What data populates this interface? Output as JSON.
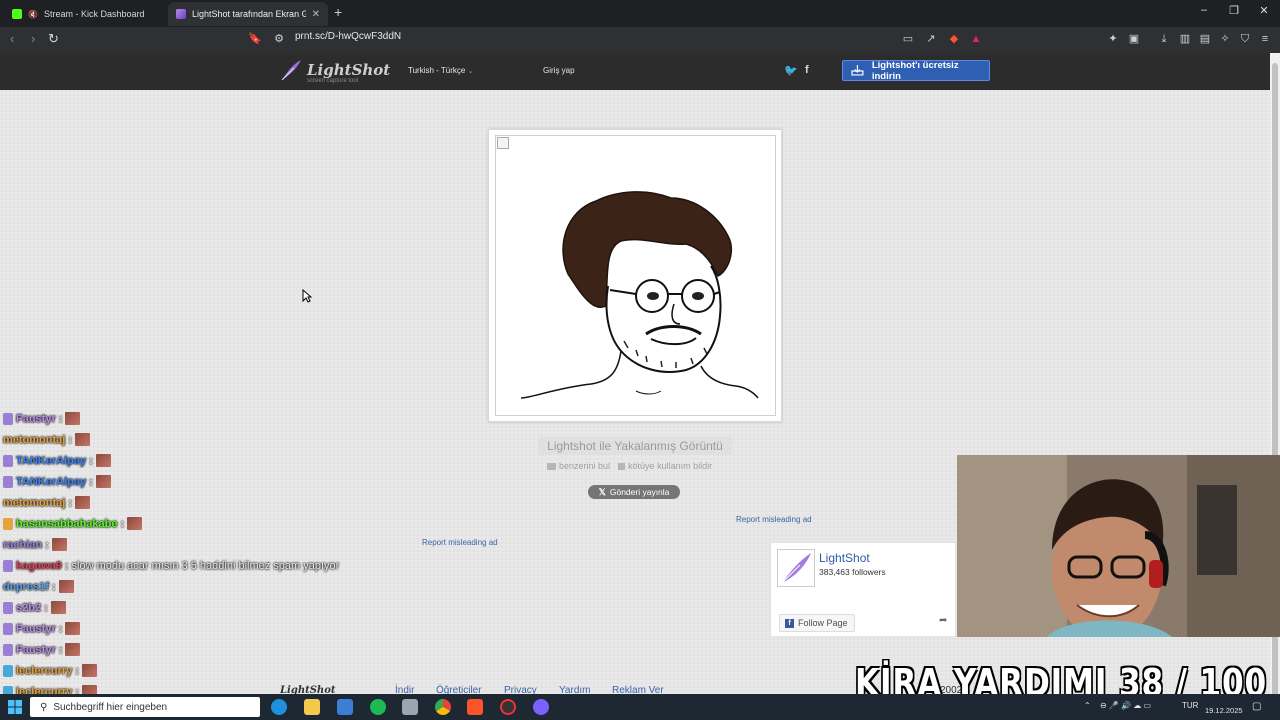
{
  "browser": {
    "tabs": [
      {
        "title": "Stream - Kick Dashboard",
        "active": false
      },
      {
        "title": "LightShot tarafından Ekran Görü",
        "active": true
      }
    ],
    "url": "prnt.sc/D-hwQcwF3ddN"
  },
  "lightshot": {
    "logo_text": "LightShot",
    "logo_sub": "screen capture tool",
    "language": "Turkish - Türkçe",
    "login": "Giriş yap",
    "download_button": "Lightshot'ı ücretsiz indirin",
    "image_caption": "Lightshot ile Yakalanmış Görüntü",
    "find_similar": "benzerini bul",
    "report_abuse": "kötüye kullanım bildir",
    "tweet_button": "Gönderi yayınla",
    "report_ad_left": "Report misleading ad",
    "report_ad_right": "Report misleading ad",
    "fb_page_name": "LightShot",
    "fb_followers": "383,463 followers",
    "fb_follow_button": "Follow Page",
    "footer": {
      "download": "İndir",
      "tutorials": "Öğreticiler",
      "privacy": "Privacy",
      "help": "Yardım",
      "ads": "Reklam Ver",
      "year": "2002"
    }
  },
  "chat": [
    {
      "user": "Faustyr",
      "color": "#b88be8",
      "badge": "#9b7fd6",
      "message": ""
    },
    {
      "user": "metomontaj",
      "color": "#e6a23c",
      "badge": "",
      "message": ""
    },
    {
      "user": "TANKerAlpay",
      "color": "#3b82f6",
      "badge": "#9b7fd6",
      "message": ""
    },
    {
      "user": "TANKerAlpay",
      "color": "#3b82f6",
      "badge": "#9b7fd6",
      "message": ""
    },
    {
      "user": "metomontaj",
      "color": "#e6a23c",
      "badge": "",
      "message": ""
    },
    {
      "user": "hasansabbahakabe",
      "color": "#53fc18",
      "badge": "#e6a23c",
      "message": ""
    },
    {
      "user": "rachian",
      "color": "#9b7fd6",
      "badge": "",
      "message": ""
    },
    {
      "user": "kagawa9",
      "color": "#e0405a",
      "badge": "#9b7fd6",
      "message": "slow modu acar mısın 3 5 haddini bilmez spam yapıyor"
    },
    {
      "user": "depres1f",
      "color": "#5aa0e6",
      "badge": "",
      "message": ""
    },
    {
      "user": "s2b2",
      "color": "#b88be8",
      "badge": "#9b7fd6",
      "message": ""
    },
    {
      "user": "Faustyr",
      "color": "#b88be8",
      "badge": "#9b7fd6",
      "message": ""
    },
    {
      "user": "Faustyr",
      "color": "#b88be8",
      "badge": "#9b7fd6",
      "message": ""
    },
    {
      "user": "leclercurry",
      "color": "#e6a23c",
      "badge": "#4aa8d8",
      "message": ""
    },
    {
      "user": "leclercurry",
      "color": "#e6a23c",
      "badge": "#4aa8d8",
      "message": ""
    },
    {
      "user": "leclercurry",
      "color": "#e6a23c",
      "badge": "#4aa8d8",
      "message": ""
    }
  ],
  "overlay": {
    "counter_text": "KİRA YARDIMI  38 / 100"
  },
  "taskbar": {
    "search_placeholder": "Suchbegriff hier eingeben",
    "lang": "TUR",
    "date": "19.12.2025"
  }
}
